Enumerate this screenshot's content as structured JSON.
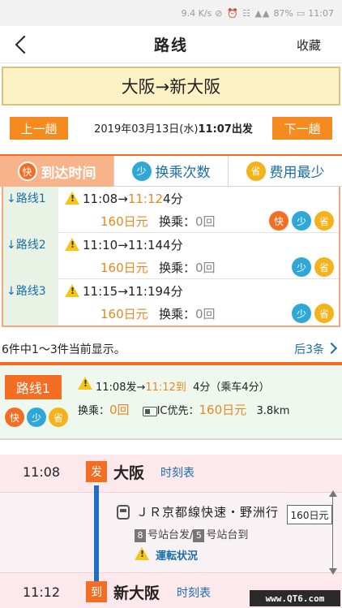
{
  "status_bar": {
    "speed": "9.4 K/s",
    "battery": "87%",
    "time": "11:07"
  },
  "nav": {
    "title": "路线",
    "favorite": "收藏"
  },
  "route": {
    "from_to": "大阪→新大阪"
  },
  "day_nav": {
    "prev": "上一趟",
    "next": "下一趟",
    "date": "2019年03月13日(水)",
    "depart": "11:07出发"
  },
  "sort_tabs": [
    {
      "badge": "快",
      "label": "到达时间",
      "active": true
    },
    {
      "badge": "少",
      "label": "换乘次数",
      "active": false
    },
    {
      "badge": "省",
      "label": "费用最少",
      "active": false
    }
  ],
  "routes": [
    {
      "label": "路线1",
      "dep": "11:08",
      "arrow": "→",
      "arr": "11:12",
      "duration": "4分",
      "fare": "160日元",
      "transfer_label": "换乘：",
      "transfer": "0回",
      "badges": [
        "快",
        "少",
        "省"
      ]
    },
    {
      "label": "路线2",
      "dep": "11:10",
      "arrow": "→",
      "arr": "11:14",
      "duration": "4分",
      "fare": "160日元",
      "transfer_label": "换乘：",
      "transfer": "0回",
      "badges": [
        "少",
        "省"
      ]
    },
    {
      "label": "路线3",
      "dep": "11:15",
      "arrow": "→",
      "arr": "11:19",
      "duration": "4分",
      "fare": "160日元",
      "transfer_label": "换乘：",
      "transfer": "0回",
      "badges": [
        "少",
        "省"
      ]
    }
  ],
  "count": {
    "text": "6件中1～3件当前显示。",
    "next": "后3条"
  },
  "detail": {
    "route_label": "路线1",
    "badges": [
      "快",
      "少",
      "省"
    ],
    "dep_text": "11:08发→",
    "arr_text": "11:12到",
    "duration_text": "4分（乘车4分）",
    "transfer_label": "换乘：",
    "transfer_value": "0回",
    "ic_label": "IC优先：",
    "fare": "160日元",
    "distance": "3.8km"
  },
  "timeline": {
    "start_time": "11:08",
    "start_tag": "发",
    "start_station": "大阪",
    "timetable_label": "时刻表",
    "line_name": "ＪＲ京都線快速・野洲行",
    "dep_platform_num": "8",
    "dep_platform_text": "号站台发",
    "sep": "/",
    "arr_platform_num": "5",
    "arr_platform_text": "号站台到",
    "status_link": "運転状況",
    "fare": "160日元",
    "end_time": "11:12",
    "end_tag": "到",
    "end_station": "新大阪"
  },
  "watermark": "www.QT6.com",
  "colors": {
    "accent_orange": "#f36e23",
    "link_blue": "#1a6ea8",
    "badge_blue": "#2fa8d8",
    "badge_yellow": "#f5b21a"
  }
}
